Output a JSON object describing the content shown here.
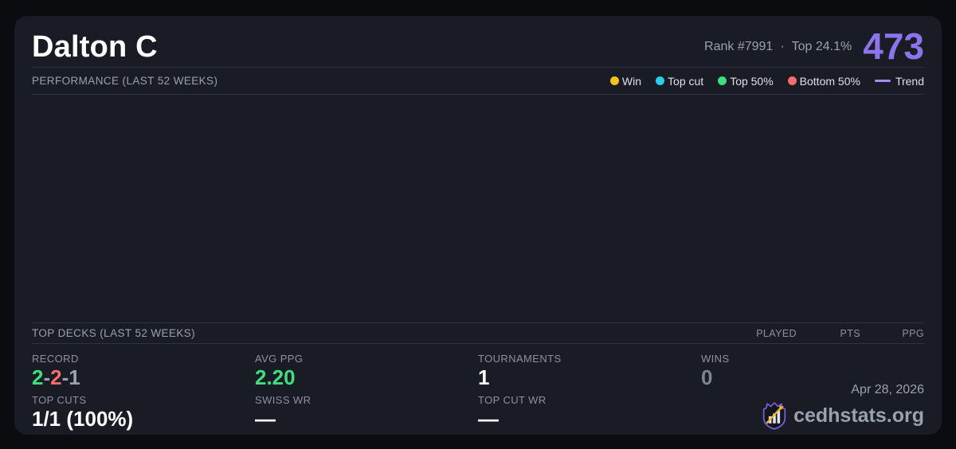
{
  "player": {
    "name": "Dalton C",
    "rank_label": "Rank #7991",
    "separator": "·",
    "top_percent_label": "Top 24.1%",
    "points": "473"
  },
  "performance": {
    "title": "PERFORMANCE (LAST 52 WEEKS)",
    "chart_empty": true,
    "legend": [
      {
        "label": "Win",
        "color": "#f0c41f"
      },
      {
        "label": "Top cut",
        "color": "#26d0e8"
      },
      {
        "label": "Top 50%",
        "color": "#3edd7d"
      },
      {
        "label": "Bottom 50%",
        "color": "#f56d6d"
      }
    ],
    "trend": {
      "label": "Trend",
      "color": "#a78bfa"
    }
  },
  "top_decks": {
    "title": "TOP DECKS (LAST 52 WEEKS)",
    "columns": [
      "PLAYED",
      "PTS",
      "PPG"
    ]
  },
  "stats": {
    "record": {
      "label": "RECORD",
      "wins": "2",
      "dash1": "-",
      "losses": "2",
      "dash2": "-",
      "draws": "1"
    },
    "avg_ppg": {
      "label": "AVG PPG",
      "value": "2.20"
    },
    "tournaments": {
      "label": "TOURNAMENTS",
      "value": "1"
    },
    "wins": {
      "label": "WINS",
      "value": "0"
    },
    "top_cuts": {
      "label": "TOP CUTS",
      "value": "1/1 (100%)"
    },
    "swiss_wr": {
      "label": "SWISS WR",
      "value": "—"
    },
    "top_cut_wr": {
      "label": "TOP CUT WR",
      "value": "—"
    }
  },
  "footer": {
    "date": "Apr 28, 2026",
    "site": "cedhstats.org"
  },
  "colors": {
    "accent_purple": "#8b74ec",
    "trend_purple": "#a78bfa",
    "green": "#3edd7d",
    "red": "#f56d6d",
    "yellow": "#f0c41f",
    "cyan": "#26d0e8",
    "gray_value": "#9ca3af",
    "dim_value": "#7d8492",
    "card_bg": "#191c25",
    "page_bg": "#0b0c10"
  }
}
